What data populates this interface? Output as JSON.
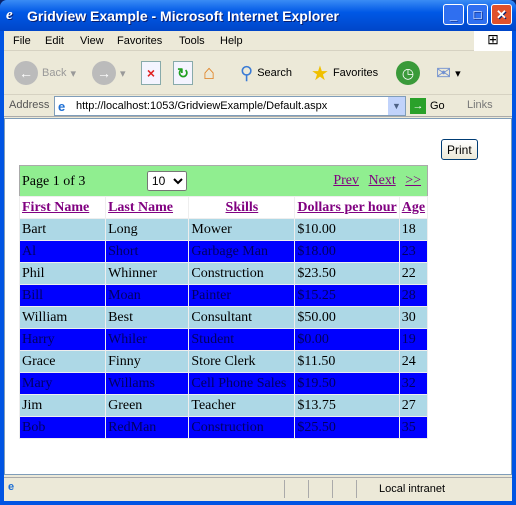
{
  "window": {
    "title": "Gridview Example - Microsoft Internet Explorer"
  },
  "menu": [
    "File",
    "Edit",
    "View",
    "Favorites",
    "Tools",
    "Help"
  ],
  "toolbar": {
    "back": "Back",
    "search": "Search",
    "favorites": "Favorites"
  },
  "address": {
    "label": "Address",
    "url": "http://localhost:1053/GridviewExample/Default.aspx",
    "go": "Go",
    "links": "Links"
  },
  "page": {
    "print_label": "Print",
    "pager": {
      "text": "Page 1 of 3",
      "page_size": "10",
      "prev": "Prev",
      "next": "Next",
      "last": ">>"
    },
    "columns": [
      "First Name",
      "Last Name",
      "Skills",
      "Dollars per hour",
      "Age"
    ],
    "rows": [
      [
        "Bart",
        "Long",
        "Mower",
        "$10.00",
        "18"
      ],
      [
        "Al",
        "Short",
        "Garbage Man",
        "$18.00",
        "23"
      ],
      [
        "Phil",
        "Whinner",
        "Construction",
        "$23.50",
        "22"
      ],
      [
        "Bill",
        "Moan",
        "Painter",
        "$15.25",
        "28"
      ],
      [
        "William",
        "Best",
        "Consultant",
        "$50.00",
        "30"
      ],
      [
        "Harry",
        "Whiler",
        "Student",
        "$0.00",
        "19"
      ],
      [
        "Grace",
        "Finny",
        "Store Clerk",
        "$11.50",
        "24"
      ],
      [
        "Mary",
        "Willams",
        "Cell Phone Sales",
        "$19.50",
        "32"
      ],
      [
        "Jim",
        "Green",
        "Teacher",
        "$13.75",
        "27"
      ],
      [
        "Bob",
        "RedMan",
        "Construction",
        "$25.50",
        "35"
      ]
    ]
  },
  "status": {
    "zone": "Local intranet"
  },
  "colors": {
    "row": "#add8e6",
    "alt_row": "#0000ff",
    "pager": "#90ee90",
    "header_link": "#800080"
  }
}
